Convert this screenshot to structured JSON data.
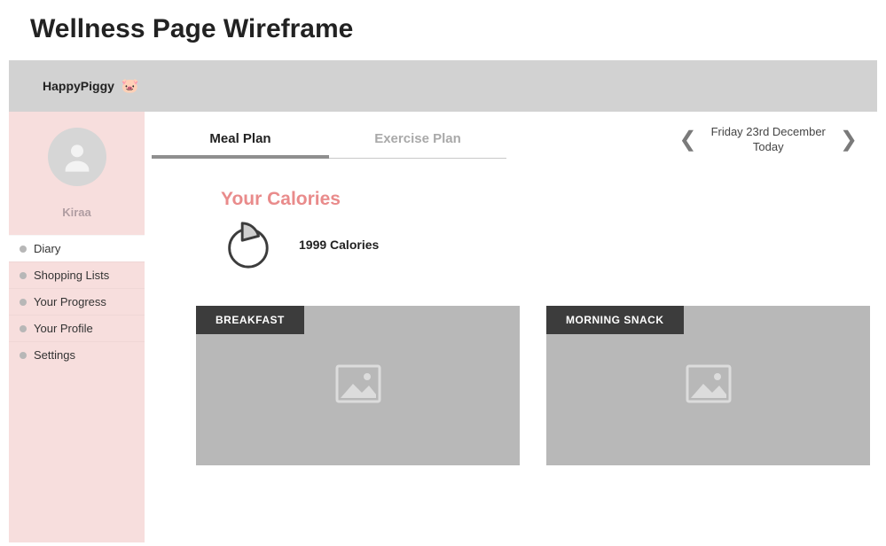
{
  "page_title": "Wellness Page Wireframe",
  "banner": {
    "logo_text": "HappyPiggy"
  },
  "sidebar": {
    "username": "Kiraa",
    "items": [
      {
        "label": "Diary",
        "active": true
      },
      {
        "label": "Shopping Lists",
        "active": false
      },
      {
        "label": "Your Progress",
        "active": false
      },
      {
        "label": "Your Profile",
        "active": false
      },
      {
        "label": "Settings",
        "active": false
      }
    ]
  },
  "tabs": [
    {
      "label": "Meal Plan",
      "active": true
    },
    {
      "label": "Exercise Plan",
      "active": false
    }
  ],
  "date_nav": {
    "line1": "Friday 23rd December",
    "line2": "Today"
  },
  "calories": {
    "title": "Your Calories",
    "value_text": "1999 Calories"
  },
  "meals": [
    {
      "label": "BREAKFAST"
    },
    {
      "label": "MORNING SNACK"
    }
  ]
}
